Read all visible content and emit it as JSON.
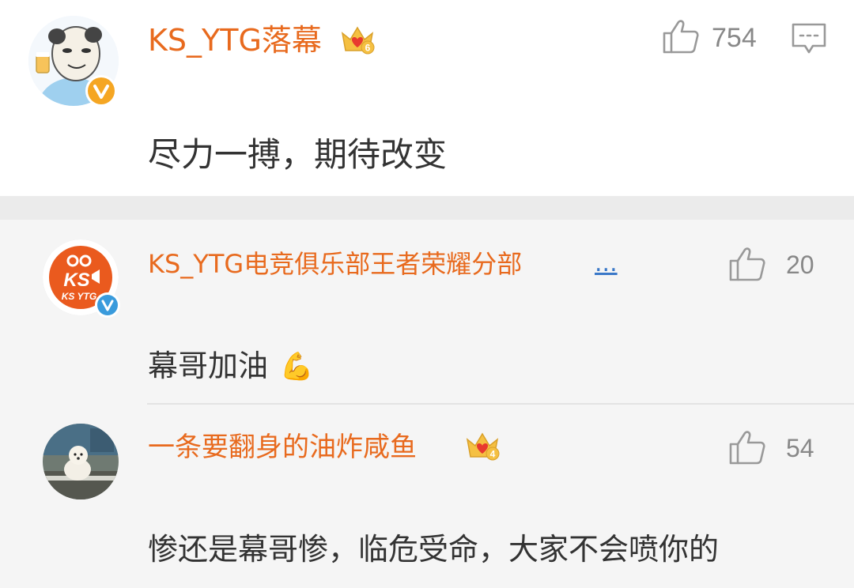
{
  "main_comment": {
    "username": "KS_YTG落幕",
    "crown_level": "6",
    "like_count": "754",
    "text": "尽力一搏，期待改变",
    "avatar_icon": "meme-face-avatar",
    "badge_icon": "gold-verified-v-icon"
  },
  "replies": [
    {
      "username": "KS_YTG电竞俱乐部王者荣耀分部",
      "ellipsis": "...",
      "like_count": "20",
      "text": "幕哥加油",
      "emoji": "💪",
      "avatar_icon": "ksytg-logo-avatar",
      "avatar_logo_line1": "KS",
      "avatar_logo_line2": "KS YTG",
      "badge_icon": "blue-verified-v-icon"
    },
    {
      "username": "一条要翻身的油炸咸鱼",
      "crown_level": "4",
      "like_count": "54",
      "text": "惨还是幕哥惨，临危受命，大家不会喷你的",
      "avatar_icon": "dog-photo-avatar"
    }
  ],
  "colors": {
    "username": "#e86a1e",
    "text": "#333333",
    "like_gray": "#888888",
    "crown_gold": "#f5c042",
    "crown_red": "#e8392f",
    "verified_gold": "#f5a623",
    "verified_blue": "#3a9bdc"
  }
}
